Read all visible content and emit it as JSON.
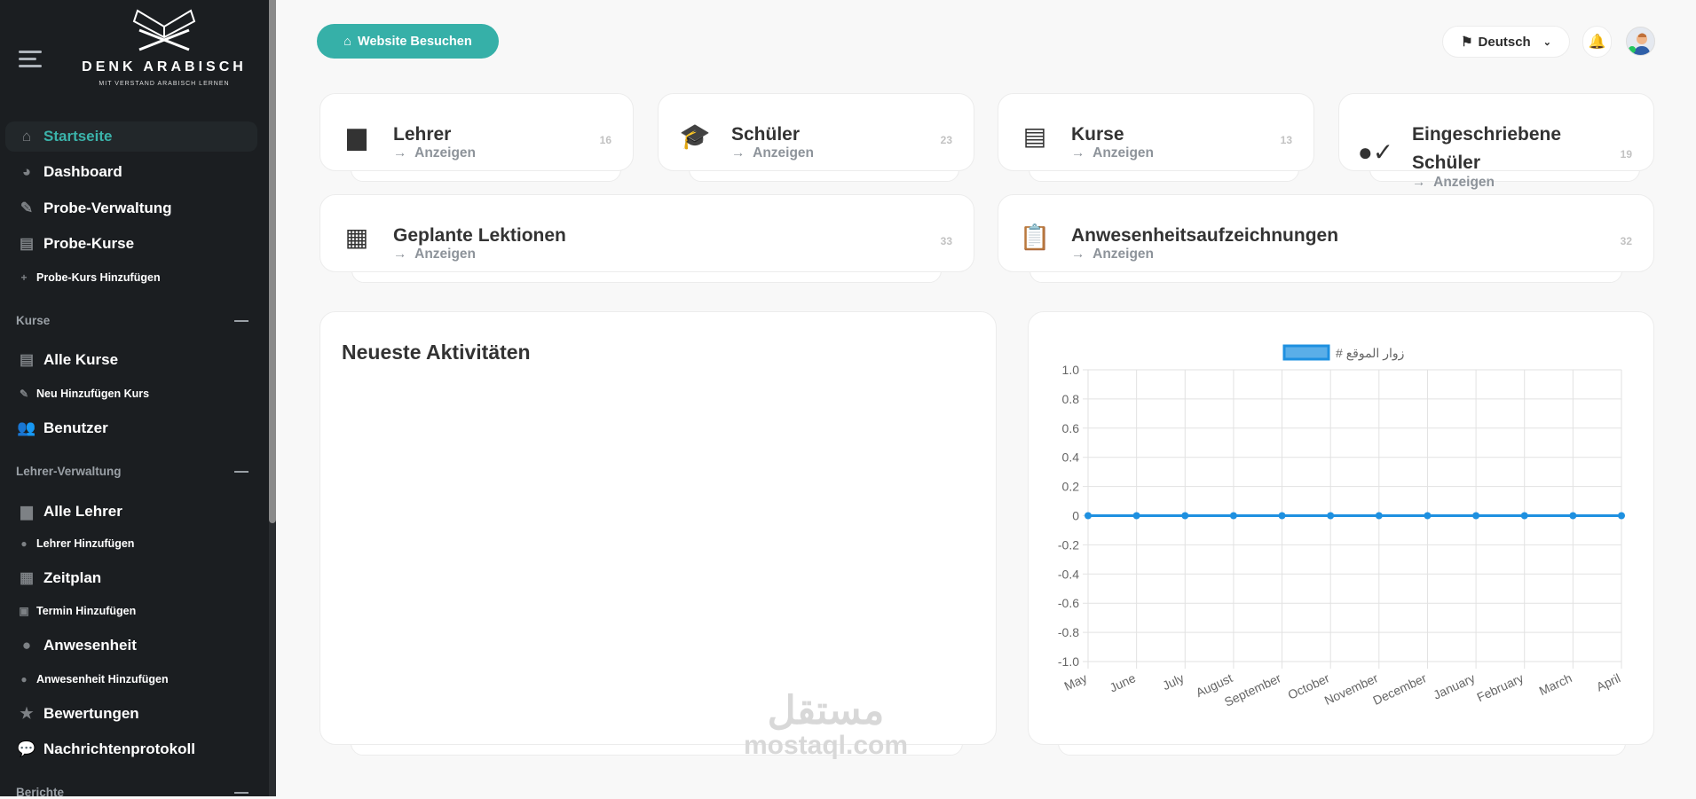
{
  "sidebar": {
    "logo": {
      "title": "DENK ARABISCH",
      "subtitle": "MIT VERSTAND ARABISCH LERNEN"
    },
    "items": [
      {
        "label": "Startseite",
        "icon": "home-icon",
        "active": true
      },
      {
        "label": "Dashboard",
        "icon": "gauge-icon"
      },
      {
        "label": "Probe-Verwaltung",
        "icon": "test-tube-icon"
      },
      {
        "label": "Probe-Kurse",
        "icon": "book-icon"
      },
      {
        "label": "Probe-Kurs Hinzufügen",
        "icon": "plus-icon"
      },
      {
        "label": "Alle Kurse",
        "icon": "book-icon"
      },
      {
        "label": "Neu Hinzufügen Kurs",
        "icon": "pencil-icon"
      },
      {
        "label": "Benutzer",
        "icon": "users-icon"
      },
      {
        "label": "Alle Lehrer",
        "icon": "chalkboard-teacher-icon"
      },
      {
        "label": "Lehrer Hinzufügen",
        "icon": "user-plus-icon"
      },
      {
        "label": "Zeitplan",
        "icon": "calendar-icon"
      },
      {
        "label": "Termin Hinzufügen",
        "icon": "calendar-plus-icon"
      },
      {
        "label": "Anwesenheit",
        "icon": "user-check-icon"
      },
      {
        "label": "Anwesenheit Hinzufügen",
        "icon": "user-check-icon"
      },
      {
        "label": "Bewertungen",
        "icon": "star-icon"
      },
      {
        "label": "Nachrichtenprotokoll",
        "icon": "comments-icon"
      }
    ],
    "sections": [
      "Kurse",
      "Lehrer-Verwaltung",
      "Berichte"
    ]
  },
  "header": {
    "visit_button": "Website Besuchen",
    "language": "Deutsch"
  },
  "stats": [
    {
      "title": "Lehrer",
      "link": "Anzeigen",
      "count": "16"
    },
    {
      "title": "Schüler",
      "link": "Anzeigen",
      "count": "23"
    },
    {
      "title": "Kurse",
      "link": "Anzeigen",
      "count": "13"
    },
    {
      "title": "Eingeschriebene Schüler",
      "link": "Anzeigen",
      "count": "19"
    },
    {
      "title": "Geplante Lektionen",
      "link": "Anzeigen",
      "count": "33"
    },
    {
      "title": "Anwesenheitsaufzeichnungen",
      "link": "Anzeigen",
      "count": "32"
    }
  ],
  "activities": {
    "title": "Neueste Aktivitäten"
  },
  "chart_data": {
    "type": "line",
    "legend": "# زوار الموقع",
    "legend_position": "top",
    "categories": [
      "May",
      "June",
      "July",
      "August",
      "September",
      "October",
      "November",
      "December",
      "January",
      "February",
      "March",
      "April"
    ],
    "series": [
      {
        "name": "# زوار الموقع",
        "values": [
          0,
          0,
          0,
          0,
          0,
          0,
          0,
          0,
          0,
          0,
          0,
          0
        ],
        "color": "#1e90e0"
      }
    ],
    "ylim": [
      -1.0,
      1.0
    ],
    "yticks": [
      "1.0",
      "0.8",
      "0.6",
      "0.4",
      "0.2",
      "0",
      "-0.2",
      "-0.4",
      "-0.6",
      "-0.8",
      "-1.0"
    ],
    "grid": true
  },
  "watermark": {
    "arabic": "مستقل",
    "latin": "mostaql.com"
  },
  "colors": {
    "accent": "#36b0a8",
    "sidebar": "#1b1e21",
    "line": "#1e90e0"
  }
}
